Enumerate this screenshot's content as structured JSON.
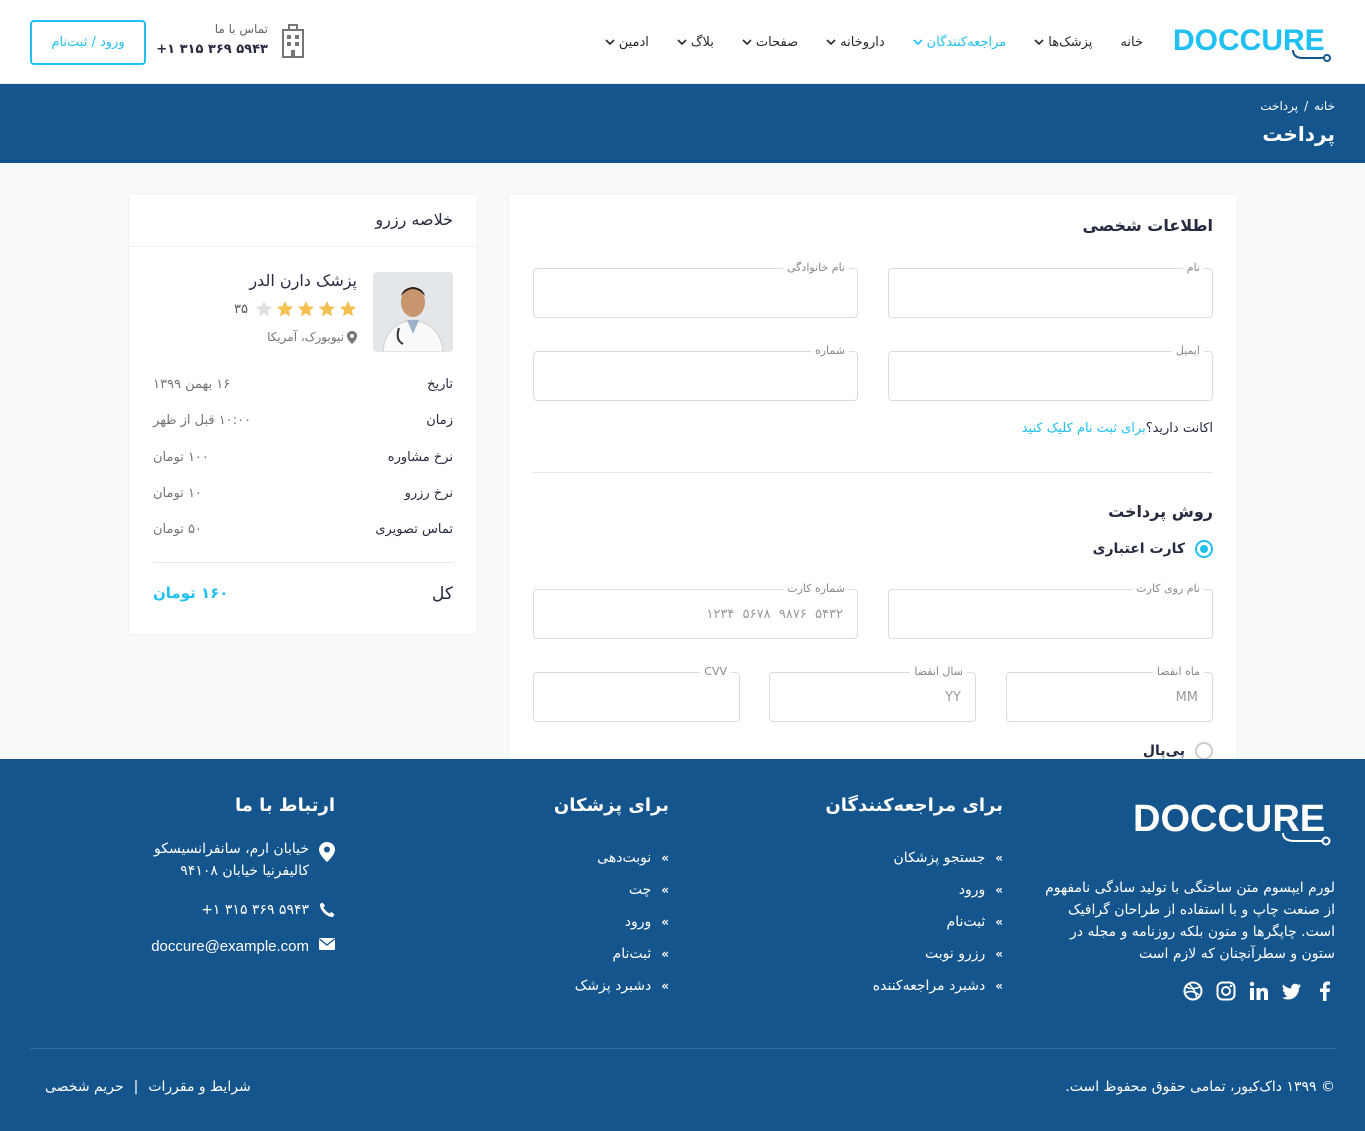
{
  "header": {
    "logo_text": "DOCCURE",
    "nav": [
      {
        "label": "خانه",
        "dropdown": false,
        "active": false
      },
      {
        "label": "پزشک‌ها",
        "dropdown": true,
        "active": false
      },
      {
        "label": "مراجعه‌کنندگان",
        "dropdown": true,
        "active": true
      },
      {
        "label": "داروخانه",
        "dropdown": true,
        "active": false
      },
      {
        "label": "صفحات",
        "dropdown": true,
        "active": false
      },
      {
        "label": "بلاگ",
        "dropdown": true,
        "active": false
      },
      {
        "label": "ادمین",
        "dropdown": true,
        "active": false
      }
    ],
    "contact_label": "تماس با ما",
    "contact_phone": "+۱ ۳۱۵ ۳۶۹ ۵۹۴۳",
    "login_button": "ورود / ثبت‌نام"
  },
  "breadcrumb": {
    "items": [
      "خانه",
      "/",
      "پرداخت"
    ],
    "title": "پرداخت"
  },
  "checkout": {
    "personal_title": "اطلاعات شخصی",
    "fields": {
      "first_name": {
        "label": "نام",
        "value": ""
      },
      "last_name": {
        "label": "نام خانوادگی",
        "value": ""
      },
      "email": {
        "label": "ایمیل",
        "value": ""
      },
      "phone": {
        "label": "شماره",
        "value": ""
      }
    },
    "account_question": "اکانت دارید؟",
    "account_link": "برای ثبت نام کلیک کنید",
    "payment_title": "روش پرداخت",
    "payment_methods": [
      {
        "label": "کارت اعتباری",
        "checked": true
      },
      {
        "label": "پی‌پال",
        "checked": false
      }
    ],
    "card": {
      "name_label": "نام روی کارت",
      "number_label": "شماره کارت",
      "number_placeholder": "۱۲۳۴  ۵۶۷۸  ۹۸۷۶  ۵۴۳۲",
      "month_label": "ماه انقضا",
      "month_placeholder": "MM",
      "year_label": "سال انقضا",
      "year_placeholder": "YY",
      "cvv_label": "CVV"
    }
  },
  "summary": {
    "title": "خلاصه رزرو",
    "doctor_name": "پزشک دارن الدر",
    "rating_stars": 4,
    "rating_max": 5,
    "rating_count": "۳۵",
    "location": "نیویورک، آمریکا",
    "rows": [
      {
        "label": "تاریخ",
        "value": "۱۶ بهمن ۱۳۹۹"
      },
      {
        "label": "زمان",
        "value": "۱۰:۰۰ قبل از ظهر"
      },
      {
        "label": "نرخ مشاوره",
        "value": "۱۰۰ تومان"
      },
      {
        "label": "نرخ رزرو",
        "value": "۱۰ تومان"
      },
      {
        "label": "تماس تصویری",
        "value": "۵۰ تومان"
      }
    ],
    "total_label": "کل",
    "total_value": "۱۶۰ تومان"
  },
  "footer": {
    "logo_text": "DOCCURE",
    "about": "لورم ایپسوم متن ساختگی با تولید سادگی نامفهوم از صنعت چاپ و با استفاده از طراحان گرافیک است. چاپگرها و متون بلکه روزنامه و مجله در ستون و سطرآنچنان که لازم است",
    "social": [
      "facebook-icon",
      "twitter-icon",
      "linkedin-icon",
      "instagram-icon",
      "dribbble-icon"
    ],
    "patients_title": "برای مراجعه‌کنندگان",
    "patients_links": [
      "جستجو پزشکان",
      "ورود",
      "ثبت‌نام",
      "رزرو نوبت",
      "دشبرد مراجعه‌کننده"
    ],
    "doctors_title": "برای پزشکان",
    "doctors_links": [
      "نوبت‌دهی",
      "چت",
      "ورود",
      "ثبت‌نام",
      "دشبرد پزشک"
    ],
    "contact_title": "ارتباط با ما",
    "address_line1": "خیابان ارم، سانفرانسیسکو",
    "address_line2": "کالیفرنیا خیابان ۹۴۱۰۸",
    "phone": "+۱ ۳۱۵ ۳۶۹ ۵۹۴۳",
    "email": "doccure@example.com",
    "copyright": "© ۱۳۹۹ داک‌کیور، تمامی حقوق محفوظ است.",
    "terms": "شرایط و مقررات",
    "separator": "|",
    "privacy": "حریم شخصی"
  },
  "colors": {
    "primary": "#20c0f3",
    "brand_dark": "#15558d",
    "star": "#f4c150"
  }
}
